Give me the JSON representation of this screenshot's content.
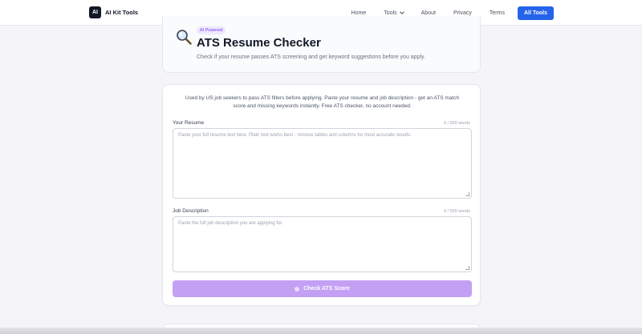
{
  "header": {
    "brand": "AI Kit Tools",
    "logo_text": "AI",
    "nav": [
      {
        "label": "Home"
      },
      {
        "label": "Tools"
      },
      {
        "label": "About"
      },
      {
        "label": "Privacy"
      },
      {
        "label": "Terms"
      }
    ],
    "cta": "All Tools"
  },
  "hero": {
    "badge": "AI Powered",
    "title": "ATS Resume Checker",
    "subtitle": "Check if your resume passes ATS screening and get keyword suggestions before you apply.",
    "icon": "magnifier-icon"
  },
  "form": {
    "intro": "Used by US job seekers to pass ATS filters before applying. Paste your resume and job description - get an ATS match score and missing keywords instantly. Free ATS checker, no account needed.",
    "resume": {
      "label": "Your Resume",
      "counter": "0 / 600 words",
      "placeholder": "Paste your full resume text here. Plain text works best - remove tables and columns for most accurate results."
    },
    "job": {
      "label": "Job Description",
      "counter": "0 / 500 words",
      "placeholder": "Paste the full job description you are applying for."
    },
    "submit": "Check ATS Score"
  },
  "colors": {
    "accent": "#2563eb",
    "badge_bg": "#ede9fe",
    "badge_text": "#7c3aed",
    "submit_bg": "#c4a0f5"
  }
}
